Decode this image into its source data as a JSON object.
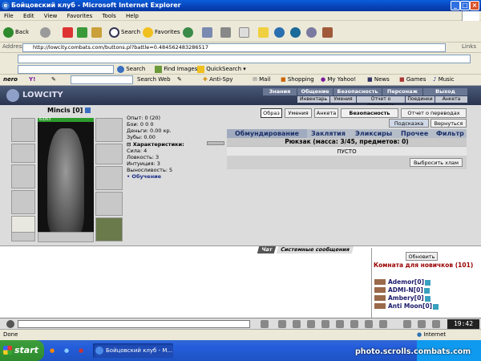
{
  "window": {
    "title": "Бойцовский клуб - Microsoft Internet Explorer"
  },
  "menubar": [
    "File",
    "Edit",
    "View",
    "Favorites",
    "Tools",
    "Help"
  ],
  "toolbar": {
    "back": "Back",
    "search": "Search",
    "favorites": "Favorites"
  },
  "address": {
    "label": "Address",
    "url": "http://lowcity.combats.com/buttons.pl?battle=0.484562483286517",
    "links": "Links"
  },
  "googlebar": {
    "search": "Search",
    "find_images": "Find Images",
    "quicksearch": "QuickSearch"
  },
  "nerobar": {
    "nero": "nero",
    "search_web": "Search Web",
    "anti_spy": "Anti-Spy",
    "mail": "Mail",
    "shopping": "Shopping",
    "my_yahoo": "My Yahoo!",
    "news": "News",
    "games": "Games",
    "music": "Music"
  },
  "game_header": {
    "logo": "LOWCITY",
    "menu": [
      "Знания",
      "Общение",
      "Безопасность",
      "Персонаж",
      "Выход"
    ],
    "submenu": [
      "Инвентарь",
      "Умения",
      "Отчет о переводах",
      "Поединки",
      "Анкета"
    ]
  },
  "character": {
    "name": "Mincis",
    "level": "[0]",
    "hp": "63/63",
    "stats": {
      "exp": "Опыт: 0 (20)",
      "battles": "Бои: 0 0 0",
      "money": "Деньги: 0.00 кр.",
      "teeth": "Зубы: 0.00",
      "characteristics_label": "Характеристики:",
      "strength": "Сила: 4",
      "agility": "Ловкость: 3",
      "intuition": "Интуиция: 3",
      "endurance": "Выносливость: 5",
      "training": "• Обучение"
    }
  },
  "buttons": {
    "obraz": "Образ",
    "umeniya": "Умения",
    "anketa": "Анкета",
    "security": "Безопасность",
    "transfer_report": "Отчет о переводах",
    "hint": "Подсказка",
    "return": "Вернуться",
    "throw_trash": "Выбросить хлам"
  },
  "inventory": {
    "tabs": [
      "Обмундирование",
      "Заклятия",
      "Эликсиры",
      "Прочее",
      "Фильтр"
    ],
    "bag_title": "Рюкзак (масса: 3/45, предметов: 0)",
    "empty": "ПУСТО"
  },
  "chat": {
    "tabs": [
      "Чат",
      "Системные сообщения"
    ],
    "refresh": "Обновить",
    "room_title": "Комната для новичков (101)",
    "users": [
      "Ademor[0]",
      "ADMI-N[0]",
      "Ambery[0]",
      "Anti Moon[0]"
    ]
  },
  "clock": "19:42",
  "statusbar": {
    "left": "Done",
    "zone": "Internet"
  },
  "taskbar": {
    "start": "start",
    "task": "Бойцовский клуб - M..."
  },
  "watermark": "photo.scrolls.combats.com"
}
